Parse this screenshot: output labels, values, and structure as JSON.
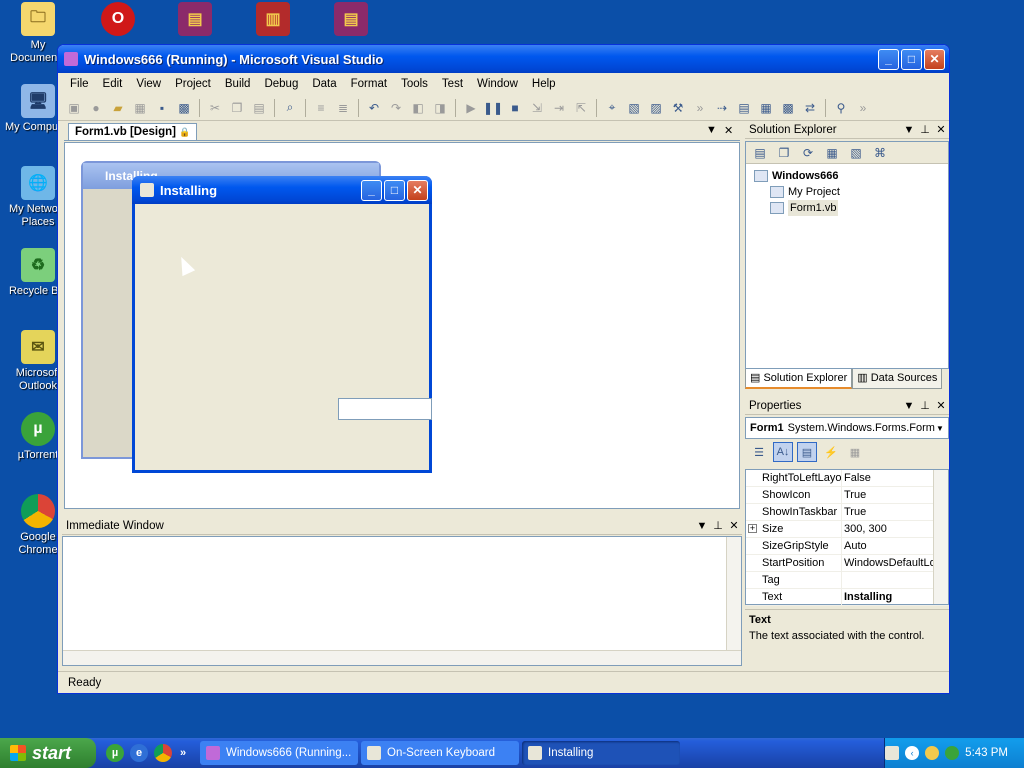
{
  "desktop": {
    "icons": [
      {
        "label": "My Documents",
        "glyph": "🗀",
        "color": "#f5d76e"
      },
      {
        "label": "My Computer",
        "glyph": "🖥",
        "color": "#8fb7e8"
      },
      {
        "label": "My Network Places",
        "glyph": "🌐",
        "color": "#6fb7e8"
      },
      {
        "label": "Recycle Bin",
        "glyph": "♻",
        "color": "#7ccf7c"
      },
      {
        "label": "Microsoft Outlook",
        "glyph": "✉",
        "color": "#e4d45a"
      },
      {
        "label": "µTorrent",
        "glyph": "µ",
        "color": "#3aa33a"
      },
      {
        "label": "Google Chrome",
        "glyph": "◉",
        "color": "#e8e8e8"
      }
    ],
    "top_icons": [
      "Opera",
      "WinRAR",
      "Book",
      "WinRAR"
    ]
  },
  "vs": {
    "title": "Windows666 (Running) - Microsoft Visual Studio",
    "menu": [
      "File",
      "Edit",
      "View",
      "Project",
      "Build",
      "Debug",
      "Data",
      "Format",
      "Tools",
      "Test",
      "Window",
      "Help"
    ],
    "doc_tab": "Form1.vb [Design]",
    "form_title": "Installing",
    "immediate_title": "Immediate Window",
    "status": "Ready"
  },
  "solution_explorer": {
    "title": "Solution Explorer",
    "project": "Windows666",
    "items": [
      "My Project",
      "Form1.vb"
    ],
    "tabs": [
      "Solution Explorer",
      "Data Sources"
    ]
  },
  "properties": {
    "title": "Properties",
    "object_name": "Form1",
    "object_type": "System.Windows.Forms.Form",
    "rows": [
      {
        "name": "RightToLeftLayout",
        "value": "False"
      },
      {
        "name": "ShowIcon",
        "value": "True"
      },
      {
        "name": "ShowInTaskbar",
        "value": "True"
      },
      {
        "name": "Size",
        "value": "300, 300"
      },
      {
        "name": "SizeGripStyle",
        "value": "Auto"
      },
      {
        "name": "StartPosition",
        "value": "WindowsDefaultLocation"
      },
      {
        "name": "Tag",
        "value": ""
      },
      {
        "name": "Text",
        "value": "Installing"
      }
    ],
    "desc_title": "Text",
    "desc_text": "The text associated with the control."
  },
  "running_window": {
    "title": "Installing"
  },
  "taskbar": {
    "start": "start",
    "tasks": [
      "Windows666 (Running...",
      "On-Screen Keyboard",
      "Installing"
    ],
    "clock": "5:43 PM"
  }
}
